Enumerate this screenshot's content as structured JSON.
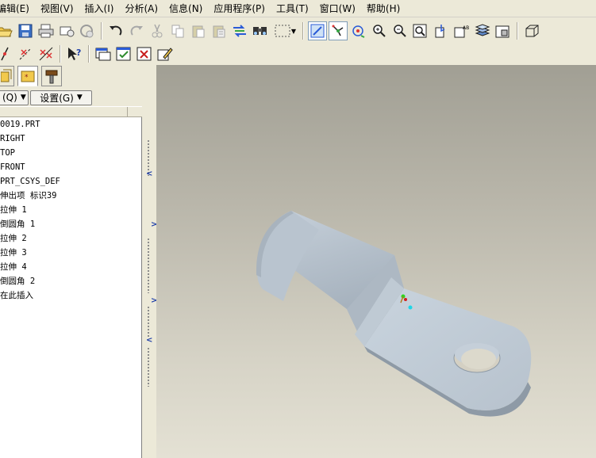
{
  "menu": [
    {
      "label": "编辑(E)"
    },
    {
      "label": "视图(V)"
    },
    {
      "label": "插入(I)"
    },
    {
      "label": "分析(A)"
    },
    {
      "label": "信息(N)"
    },
    {
      "label": "应用程序(P)"
    },
    {
      "label": "工具(T)"
    },
    {
      "label": "窗口(W)"
    },
    {
      "label": "帮助(H)"
    }
  ],
  "toolbar1_icons": [
    "open-folder-icon",
    "save-icon",
    "print-icon",
    "send-mail-icon",
    "link-icon",
    "undo-icon",
    "redo-icon",
    "cut-icon",
    "copy-icon",
    "paste-icon",
    "paste-special-icon",
    "regenerate-icon",
    "find-icon",
    "select-box-icon",
    "view-repaint-icon",
    "spin-center-icon",
    "orient-mode-icon",
    "zoom-in-icon",
    "zoom-out-icon",
    "refit-icon",
    "reorient-icon",
    "saved-views-icon",
    "layers-icon",
    "view-manager-icon",
    "shaded-view-icon"
  ],
  "toolbar2_icons": [
    "datum-planes-icon",
    "datum-axes-icon",
    "datum-points-icon",
    "whats-this-icon",
    "new-window-icon",
    "activate-window-icon",
    "close-window-icon",
    "edit-icon"
  ],
  "controls": {
    "show_label": "(Q)",
    "settings_label": "设置(G)"
  },
  "tree": [
    {
      "label": "0019.PRT"
    },
    {
      "label": "RIGHT"
    },
    {
      "label": "TOP"
    },
    {
      "label": "FRONT"
    },
    {
      "label": "PRT_CSYS_DEF"
    },
    {
      "label": "伸出项 标识39"
    },
    {
      "label": "拉伸 1"
    },
    {
      "label": "倒圆角 1"
    },
    {
      "label": "拉伸 2"
    },
    {
      "label": "拉伸 3"
    },
    {
      "label": "拉伸 4"
    },
    {
      "label": "倒圆角 2"
    },
    {
      "label": "在此插入"
    }
  ],
  "colors": {
    "chrome": "#ece9d8",
    "model_body": "#b8c3cd",
    "viewport_top": "#a19f94",
    "viewport_bottom": "#e4e1d4"
  }
}
